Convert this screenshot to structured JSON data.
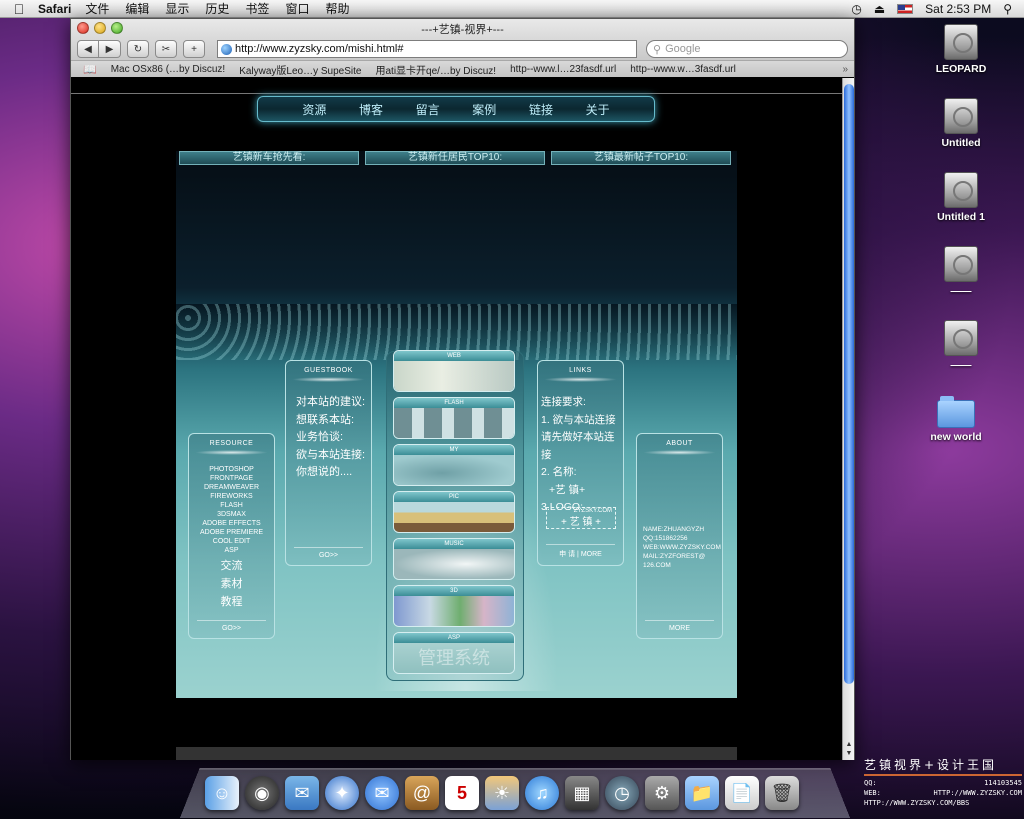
{
  "menubar": {
    "apple": "",
    "app": "Safari",
    "items": [
      "文件",
      "编辑",
      "显示",
      "历史",
      "书签",
      "窗口",
      "帮助"
    ],
    "clock": "Sat 2:53 PM"
  },
  "window": {
    "title": "---+艺镇-视界+---",
    "url": "http://www.zyzsky.com/mishi.html#",
    "search_placeholder": "Google",
    "bookmarks": [
      "Mac OSx86 (…by Discuz!",
      "Kalyway版Leo…y SupeSite",
      "用ati显卡开qe/…by Discuz!",
      "http--www.l…23fasdf.url",
      "http--www.w…3fasdf.url"
    ]
  },
  "site": {
    "nav": [
      "资源",
      "博客",
      "留言",
      "案例",
      "链接",
      "关于"
    ],
    "topbars": [
      "艺镇新车抢先看:",
      "艺镇新任居民TOP10:",
      "艺镇最新帖子TOP10:"
    ],
    "resource": {
      "title": "RESOURCE",
      "items": [
        "PHOTOSHOP",
        "FRONTPAGE",
        "DREAMWEAVER",
        "FIREWORKS",
        "FLASH",
        "3DSMAX",
        "ADOBE EFFECTS",
        "ADOBE PREMIERE",
        "COOL EDIT",
        "ASP"
      ],
      "cn_items": [
        "交流",
        "素材",
        "教程"
      ],
      "footer": "GO>>"
    },
    "guestbook": {
      "title": "GUESTBOOK",
      "lines": [
        "对本站的建议:",
        "想联系本站:",
        "业务恰谈:",
        "欲与本站连接:",
        "你想说的...."
      ],
      "footer": "GO>>"
    },
    "tiles": [
      "WEB",
      "FLASH",
      "MY",
      "PIC",
      "MUSIC",
      "3D",
      "ASP"
    ],
    "tile_overlay": "管理系统",
    "links": {
      "title": "LINKS",
      "lines": [
        "连接要求:",
        "1. 欲与本站连接",
        "请先做好本站连接",
        "2. 名称:",
        "  +艺 镇+",
        "3.LOGO:"
      ],
      "logo_small": "ZYZSKY.COM",
      "logo_big": "+ 艺 镇 +",
      "footer": "申 请 | MORE"
    },
    "about": {
      "title": "ABOUT",
      "lines": [
        "NAME:ZHUANGYZH",
        "QQ:151862256",
        "WEB:WWW.ZYZSKY.COM",
        "MAIL:ZYZFOREST@",
        "126.COM"
      ],
      "footer": "MORE"
    }
  },
  "desktop": {
    "icons": [
      "LEOPARD",
      "Untitled",
      "Untitled 1",
      "——",
      "——",
      "new world"
    ]
  },
  "watermark": {
    "title": "艺镇视界+设计王国",
    "qq_label": "QQ:",
    "qq": "114103545",
    "web_label": "WEB:",
    "web": "HTTP://WWW.ZYZSKY.COM",
    "url": "HTTP://WWW.ZYZSKY.COM/BBS"
  },
  "colors": {
    "accent": "#2a6ad8",
    "site_teal": "#5aa9ae"
  }
}
